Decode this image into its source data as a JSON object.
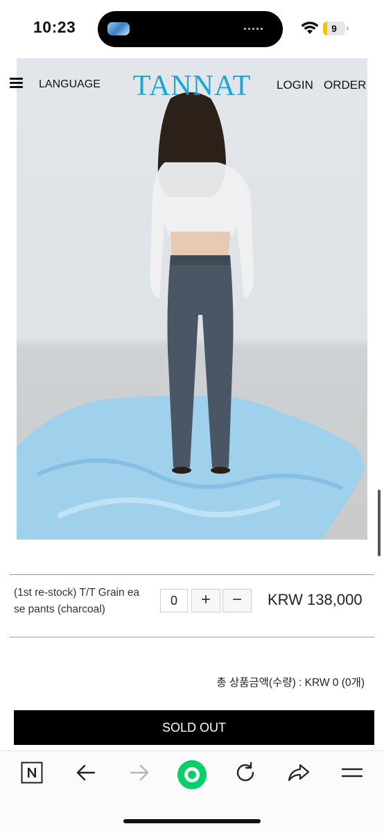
{
  "status_bar": {
    "time": "10:23",
    "battery_level": "9"
  },
  "header": {
    "menu_icon": "hamburger-icon",
    "language_label": "LANGUAGE",
    "logo": "TANNAT",
    "login_label": "LOGIN",
    "order_label": "ORDER"
  },
  "hero": {
    "image": "model-back-view-charcoal-pants-on-blue-fabric"
  },
  "product": {
    "name_line1": "(1st re-stock) T/T Grain ea",
    "name_line2": "se pants (charcoal)",
    "quantity": "0",
    "plus_label": "+",
    "minus_label": "−",
    "price": "KRW 138,000"
  },
  "summary": {
    "total_text": "총 상품금액(수량) : KRW 0 (0개)"
  },
  "cta": {
    "label": "SOLD OUT"
  },
  "browser_toolbar": {
    "icons": [
      "naver-n-icon",
      "back-arrow-icon",
      "forward-arrow-icon",
      "green-circle-icon",
      "refresh-icon",
      "share-icon",
      "menu-lines-icon"
    ],
    "accent": "#06d06a"
  }
}
